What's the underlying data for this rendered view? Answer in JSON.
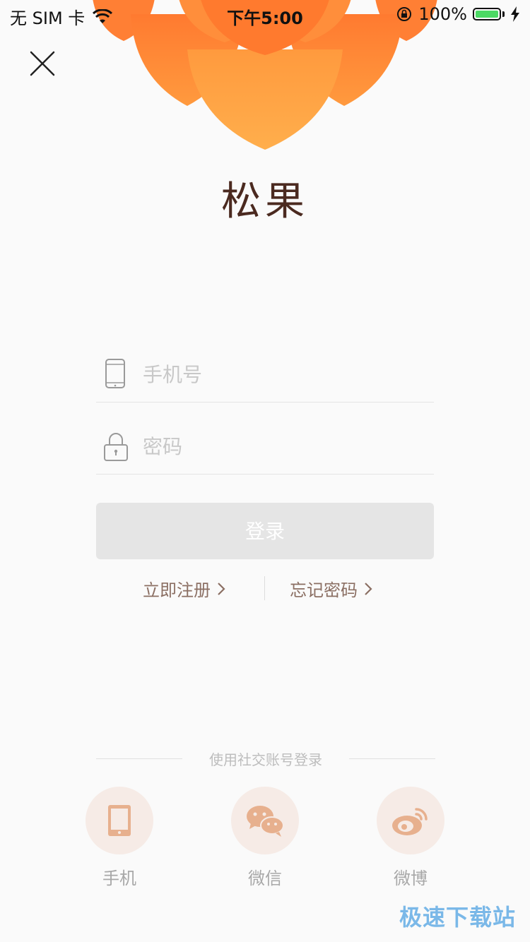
{
  "status_bar": {
    "carrier": "无 SIM 卡",
    "time": "下午5:00",
    "battery_percent": "100%",
    "battery_level": 1.0,
    "battery_color": "#4cd964"
  },
  "header": {
    "app_title": "松果"
  },
  "form": {
    "phone_placeholder": "手机号",
    "password_placeholder": "密码",
    "login_label": "登录"
  },
  "links": {
    "register": "立即注册",
    "forgot": "忘记密码"
  },
  "social": {
    "heading": "使用社交账号登录",
    "items": [
      {
        "label": "手机",
        "icon": "mobile-icon"
      },
      {
        "label": "微信",
        "icon": "wechat-icon"
      },
      {
        "label": "微博",
        "icon": "weibo-icon"
      }
    ]
  },
  "watermark": "极速下载站",
  "colors": {
    "accent": "#ff8a3d",
    "petal_light": "#ffa94a",
    "title": "#4b2a20",
    "link": "#8b6f63",
    "social_icon": "#e7b08e"
  }
}
